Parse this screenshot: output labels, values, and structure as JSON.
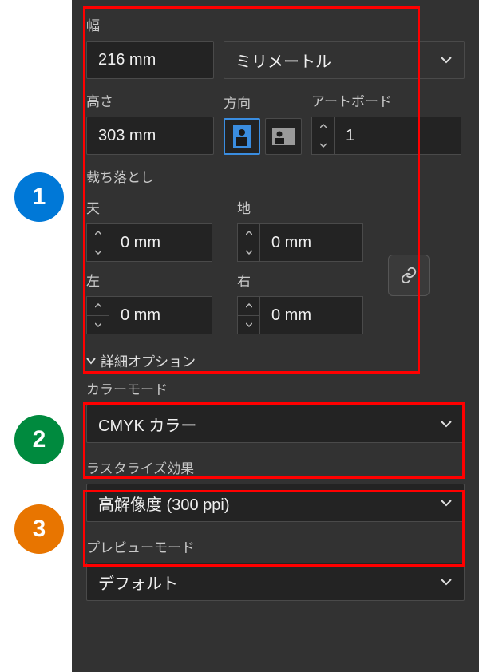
{
  "badges": {
    "b1": "1",
    "b2": "2",
    "b3": "3"
  },
  "width": {
    "label": "幅",
    "value": "216 mm"
  },
  "units": {
    "value": "ミリメートル"
  },
  "height": {
    "label": "高さ",
    "value": "303 mm"
  },
  "orientation": {
    "label": "方向"
  },
  "artboards": {
    "label": "アートボード",
    "value": "1"
  },
  "bleed": {
    "label": "裁ち落とし",
    "top": {
      "label": "天",
      "value": "0 mm"
    },
    "bottom": {
      "label": "地",
      "value": "0 mm"
    },
    "left": {
      "label": "左",
      "value": "0 mm"
    },
    "right": {
      "label": "右",
      "value": "0 mm"
    }
  },
  "advanced": {
    "label": "詳細オプション"
  },
  "colorMode": {
    "label": "カラーモード",
    "value": "CMYK カラー"
  },
  "raster": {
    "label": "ラスタライズ効果",
    "value": "高解像度 (300 ppi)"
  },
  "previewMode": {
    "label": "プレビューモード",
    "value": "デフォルト"
  }
}
